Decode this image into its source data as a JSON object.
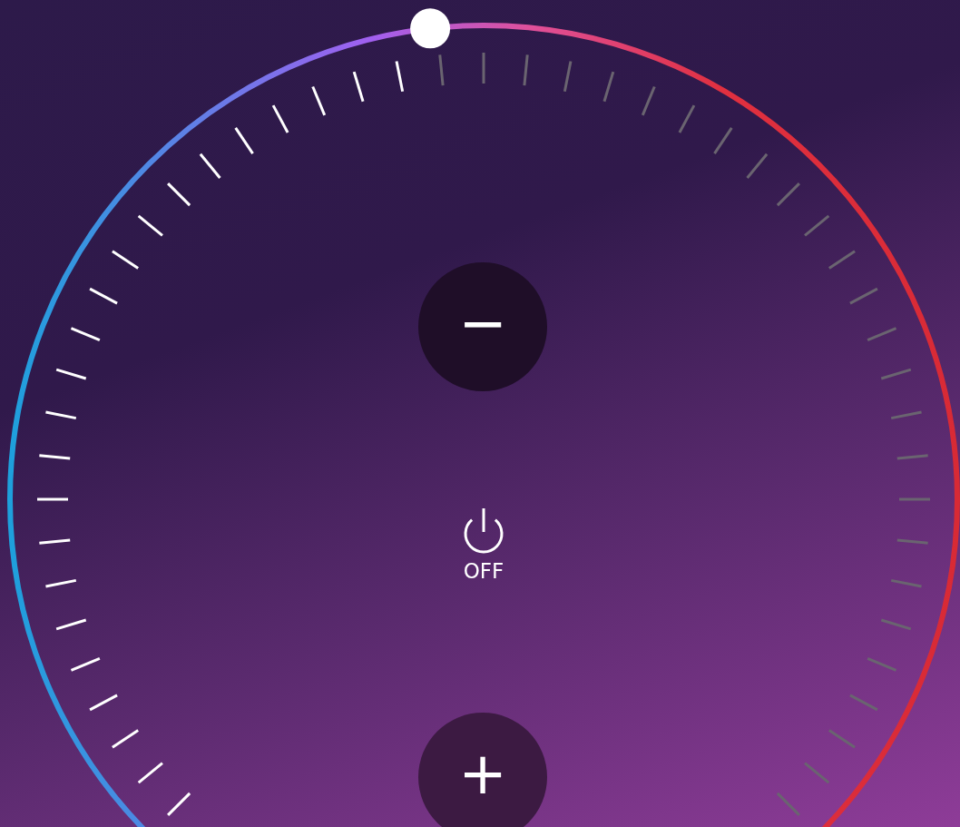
{
  "thermostat": {
    "level": 0.476,
    "power": {
      "label": "OFF",
      "on": false
    },
    "buttons": [
      {
        "kind": "decrease",
        "label": "−"
      },
      {
        "kind": "increase",
        "label": "+"
      }
    ]
  }
}
